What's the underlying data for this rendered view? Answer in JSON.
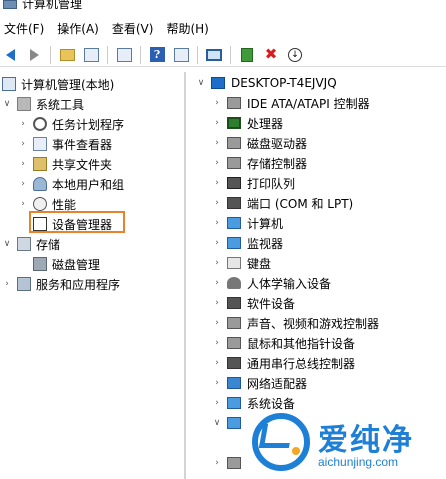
{
  "window": {
    "title": "计算机管理"
  },
  "menu": {
    "items": [
      "文件(F)",
      "操作(A)",
      "查看(V)",
      "帮助(H)"
    ]
  },
  "toolbar": {
    "icons": [
      "back-icon",
      "forward-icon",
      "up-folder-icon",
      "show-hide-tree-icon",
      "properties-icon",
      "help-icon",
      "action-pane-icon",
      "monitor-icon",
      "update-driver-icon",
      "uninstall-icon",
      "download-icon"
    ]
  },
  "tree": {
    "root": "计算机管理(本地)",
    "system_tools": "系统工具",
    "task_scheduler": "任务计划程序",
    "event_viewer": "事件查看器",
    "shared_folders": "共享文件夹",
    "local_users": "本地用户和组",
    "performance": "性能",
    "device_manager": "设备管理器",
    "storage": "存储",
    "disk_management": "磁盘管理",
    "services_apps": "服务和应用程序"
  },
  "devices": {
    "host": "DESKTOP-T4EJVJQ",
    "categories": [
      "IDE ATA/ATAPI 控制器",
      "处理器",
      "磁盘驱动器",
      "存储控制器",
      "打印队列",
      "端口 (COM 和 LPT)",
      "计算机",
      "监视器",
      "键盘",
      "人体学输入设备",
      "软件设备",
      "声音、视频和游戏控制器",
      "鼠标和其他指针设备",
      "通用串行总线控制器",
      "网络适配器",
      "系统设备"
    ]
  },
  "watermark": {
    "brand": "爱纯净",
    "url": "aichunjing.com"
  },
  "colors": {
    "highlight": "#e8822b",
    "brand": "#1e7fd6"
  }
}
